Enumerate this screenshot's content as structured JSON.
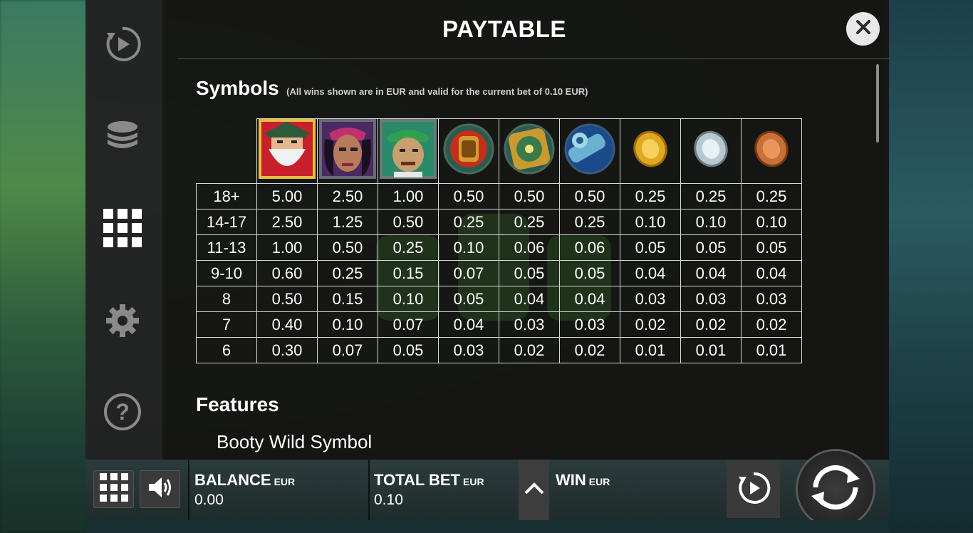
{
  "panel": {
    "title": "PAYTABLE"
  },
  "symbols_section": {
    "heading": "Symbols",
    "note": "(All wins shown are in EUR and valid for the current bet of 0.10 EUR)"
  },
  "paytable": {
    "symbols": [
      "captain-symbol",
      "pirate-woman-symbol",
      "green-pirate-symbol",
      "red-cannon-symbol",
      "gold-compass-symbol",
      "blue-telescope-symbol",
      "gold-coin-symbol",
      "silver-coin-symbol",
      "bronze-coin-symbol"
    ],
    "rows": [
      {
        "label": "18+",
        "values": [
          "5.00",
          "2.50",
          "1.00",
          "0.50",
          "0.50",
          "0.50",
          "0.25",
          "0.25",
          "0.25"
        ]
      },
      {
        "label": "14-17",
        "values": [
          "2.50",
          "1.25",
          "0.50",
          "0.25",
          "0.25",
          "0.25",
          "0.10",
          "0.10",
          "0.10"
        ]
      },
      {
        "label": "11-13",
        "values": [
          "1.00",
          "0.50",
          "0.25",
          "0.10",
          "0.06",
          "0.06",
          "0.05",
          "0.05",
          "0.05"
        ]
      },
      {
        "label": "9-10",
        "values": [
          "0.60",
          "0.25",
          "0.15",
          "0.07",
          "0.05",
          "0.05",
          "0.04",
          "0.04",
          "0.04"
        ]
      },
      {
        "label": "8",
        "values": [
          "0.50",
          "0.15",
          "0.10",
          "0.05",
          "0.04",
          "0.04",
          "0.03",
          "0.03",
          "0.03"
        ]
      },
      {
        "label": "7",
        "values": [
          "0.40",
          "0.10",
          "0.07",
          "0.04",
          "0.03",
          "0.03",
          "0.02",
          "0.02",
          "0.02"
        ]
      },
      {
        "label": "6",
        "values": [
          "0.30",
          "0.07",
          "0.05",
          "0.03",
          "0.02",
          "0.02",
          "0.01",
          "0.01",
          "0.01"
        ]
      }
    ]
  },
  "features": {
    "heading": "Features",
    "items": [
      "Booty Wild Symbol"
    ]
  },
  "bottombar": {
    "balance_label": "BALANCE",
    "balance_unit": "EUR",
    "balance_value": "0.00",
    "totalbet_label": "TOTAL BET",
    "totalbet_unit": "EUR",
    "totalbet_value": "0.10",
    "win_label": "WIN",
    "win_unit": "EUR"
  },
  "colors": {
    "panel_bg": "#161614",
    "text": "#ffffff",
    "grid": "#d8d8d8"
  }
}
